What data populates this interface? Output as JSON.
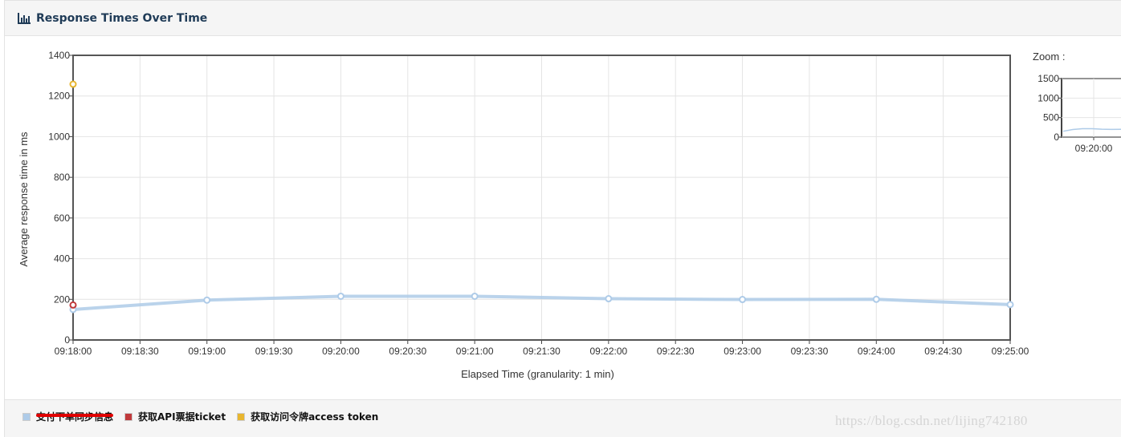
{
  "header": {
    "title": "Response Times Over Time",
    "icon": "bar-chart-icon"
  },
  "zoom": {
    "label": "Zoom :",
    "y_ticks": [
      "1500",
      "1000",
      "500",
      "0"
    ],
    "x_tick": "09:20:00"
  },
  "chart_data": {
    "type": "line",
    "xlabel": "Elapsed Time (granularity: 1 min)",
    "ylabel": "Average response time in ms",
    "ylim": [
      0,
      1400
    ],
    "y_ticks": [
      0,
      200,
      400,
      600,
      800,
      1000,
      1200,
      1400
    ],
    "x_ticks": [
      "09:18:00",
      "09:18:30",
      "09:19:00",
      "09:19:30",
      "09:20:00",
      "09:20:30",
      "09:21:00",
      "09:21:30",
      "09:22:00",
      "09:22:30",
      "09:23:00",
      "09:23:30",
      "09:24:00",
      "09:24:30",
      "09:25:00"
    ],
    "x_range": [
      "09:18:00",
      "09:25:00"
    ],
    "grid": true,
    "legend_position": "bottom",
    "series": [
      {
        "name": "支付下单同步信息",
        "color": "#aecbe8",
        "x": [
          "09:18:00",
          "09:19:00",
          "09:20:00",
          "09:21:00",
          "09:22:00",
          "09:23:00",
          "09:24:00",
          "09:25:00"
        ],
        "values": [
          150,
          196,
          215,
          215,
          203,
          199,
          200,
          174
        ]
      },
      {
        "name": "获取API票据ticket",
        "color": "#c0393b",
        "x": [
          "09:18:00"
        ],
        "values": [
          172
        ]
      },
      {
        "name": "获取访问令牌access token",
        "color": "#e8b62f",
        "x": [
          "09:18:00"
        ],
        "values": [
          1258
        ]
      }
    ]
  },
  "watermark": "https://blog.csdn.net/lijing742180"
}
